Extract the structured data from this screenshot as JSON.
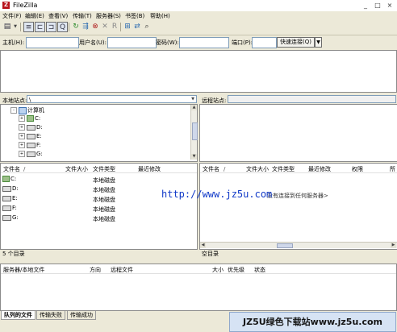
{
  "window": {
    "title": "FileZilla",
    "app_icon_letter": "Z",
    "controls": {
      "minimize": "_",
      "maximize": "□",
      "close": "×"
    }
  },
  "menu": [
    "文件(F)",
    "编辑(E)",
    "查看(V)",
    "传输(T)",
    "服务器(S)",
    "书签(B)",
    "帮助(H)"
  ],
  "toolbar": {
    "icons": [
      "site-manager-icon",
      "dropdown-arrow-icon",
      "toggle-log-icon",
      "toggle-local-tree-icon",
      "toggle-remote-tree-icon",
      "toggle-queue-icon",
      "refresh-icon",
      "process-queue-icon",
      "cancel-icon",
      "disconnect-icon",
      "reconnect-icon",
      "filter-icon",
      "compare-icon",
      "search-icon"
    ]
  },
  "quickconnect": {
    "host_label": "主机(H):",
    "user_label": "用户名(U):",
    "pass_label": "密码(W):",
    "port_label": "端口(P):",
    "host_value": "",
    "user_value": "",
    "pass_value": "",
    "port_value": "",
    "connect_label": "快速连接(Q)",
    "dropdown": "▼"
  },
  "local": {
    "site_label": "本地站点:",
    "path": "\\",
    "tree": [
      {
        "label": "计算机",
        "icon": "computer-icon",
        "level": 0,
        "expander": "-"
      },
      {
        "label": "C:",
        "icon": "drive-icon",
        "level": 1,
        "expander": "+"
      },
      {
        "label": "D:",
        "icon": "drive-icon",
        "level": 1,
        "expander": "+"
      },
      {
        "label": "E:",
        "icon": "drive-icon",
        "level": 1,
        "expander": "+"
      },
      {
        "label": "F:",
        "icon": "drive-icon",
        "level": 1,
        "expander": "+"
      },
      {
        "label": "G:",
        "icon": "drive-icon",
        "level": 1,
        "expander": "+"
      }
    ],
    "columns": [
      "文件名",
      "文件大小",
      "文件类型",
      "最近修改"
    ],
    "sort_indicator": "/",
    "files": [
      {
        "name": "C:",
        "type": "本地磁盘"
      },
      {
        "name": "D:",
        "type": "本地磁盘"
      },
      {
        "name": "E:",
        "type": "本地磁盘"
      },
      {
        "name": "F:",
        "type": "本地磁盘"
      },
      {
        "name": "G:",
        "type": "本地磁盘"
      }
    ],
    "status": "5 个目录"
  },
  "remote": {
    "site_label": "远程站点:",
    "path": "",
    "columns": [
      "文件名",
      "文件大小",
      "文件类型",
      "最近修改",
      "权限",
      "所"
    ],
    "sort_indicator": "/",
    "message": "没有连接到任何服务器>",
    "status": "空目录"
  },
  "queue": {
    "columns": [
      "服务器/本地文件",
      "方向",
      "远程文件",
      "大小",
      "优先级",
      "状态"
    ]
  },
  "tabs": [
    "队列的文件",
    "传输失败",
    "传输成功"
  ],
  "watermark": "http://www.jz5u.com",
  "banner": "JZ5U绿色下载站www.jz5u.com"
}
